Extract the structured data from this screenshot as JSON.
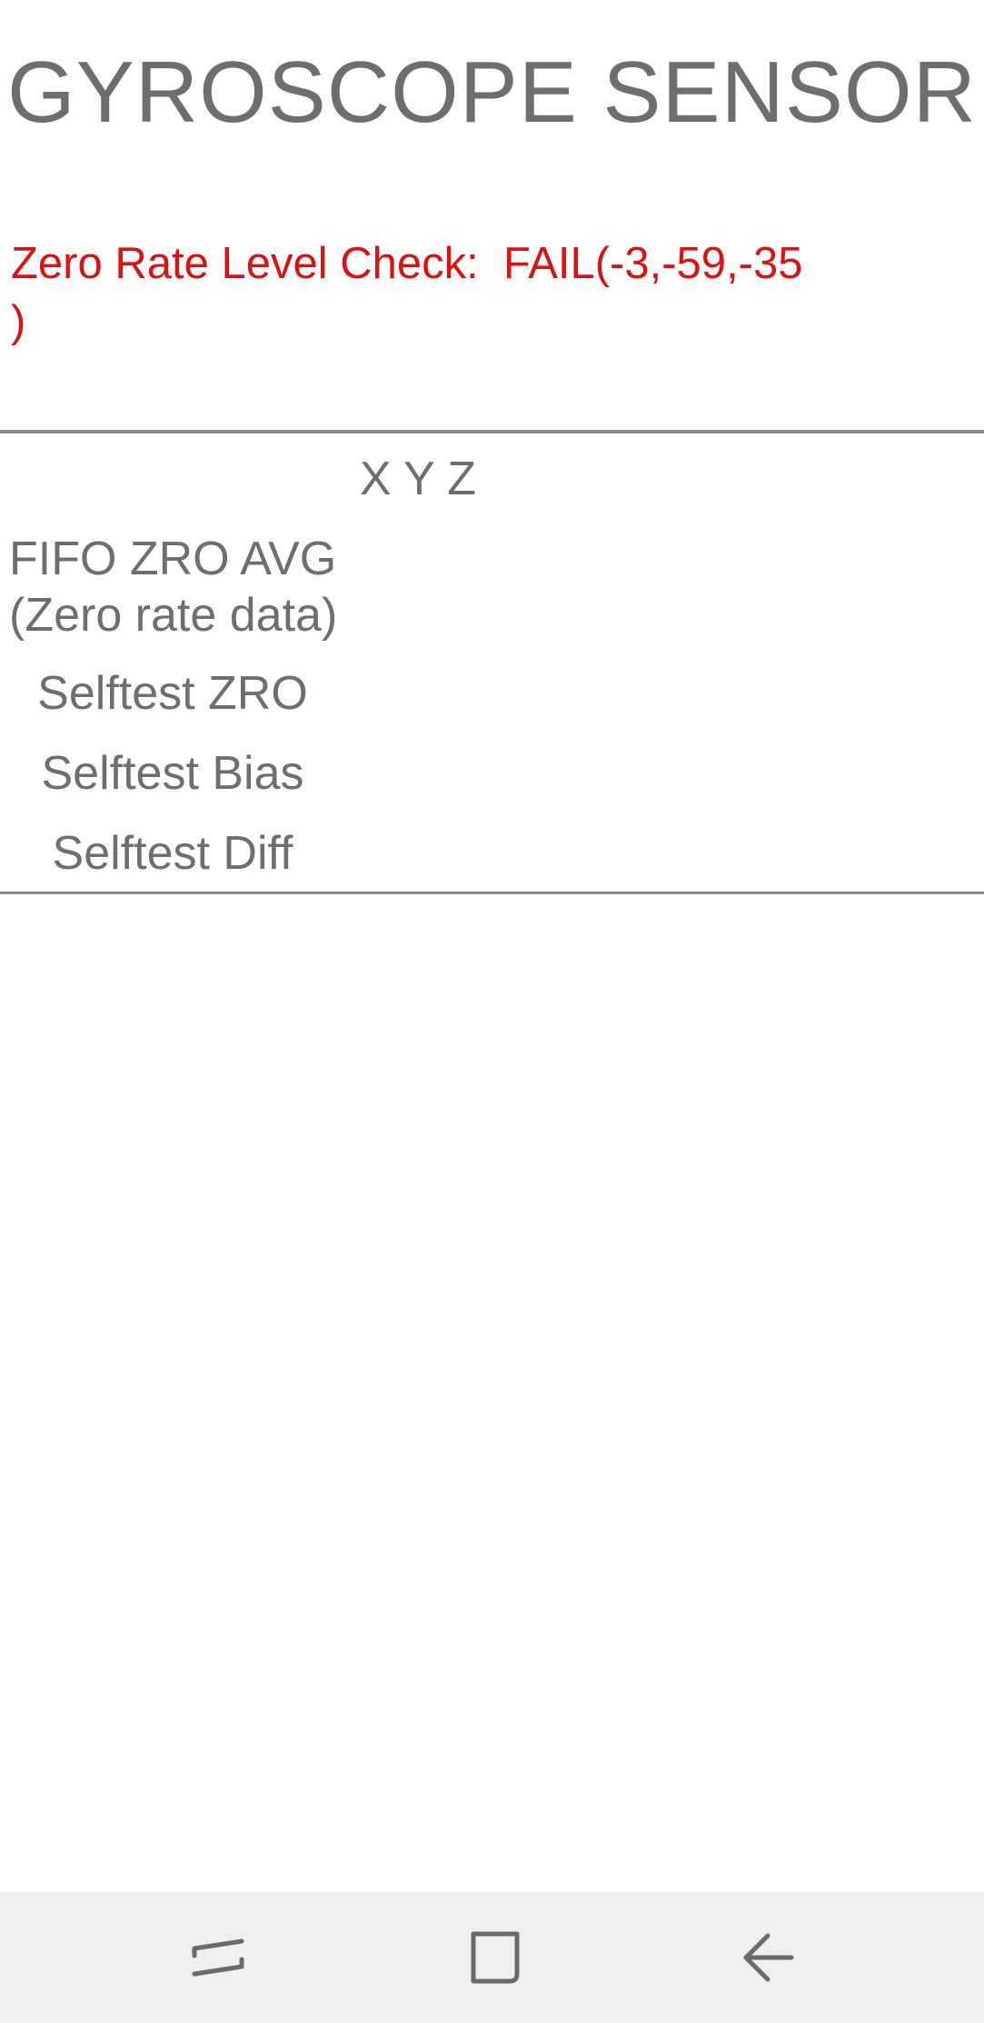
{
  "title": "GYROSCOPE SENSOR",
  "status": {
    "text": "Zero Rate Level Check:  FAIL(-3,-59,-35\n)",
    "color": "#e01010"
  },
  "table": {
    "column_header": "X Y Z",
    "rows": [
      {
        "label": "FIFO ZRO AVG\n(Zero rate data)"
      },
      {
        "label": "Selftest ZRO"
      },
      {
        "label": "Selftest Bias"
      },
      {
        "label": "Selftest Diff"
      }
    ]
  },
  "navbar": {
    "recent_icon": "recent-apps-icon",
    "home_icon": "home-icon",
    "back_icon": "back-icon"
  }
}
